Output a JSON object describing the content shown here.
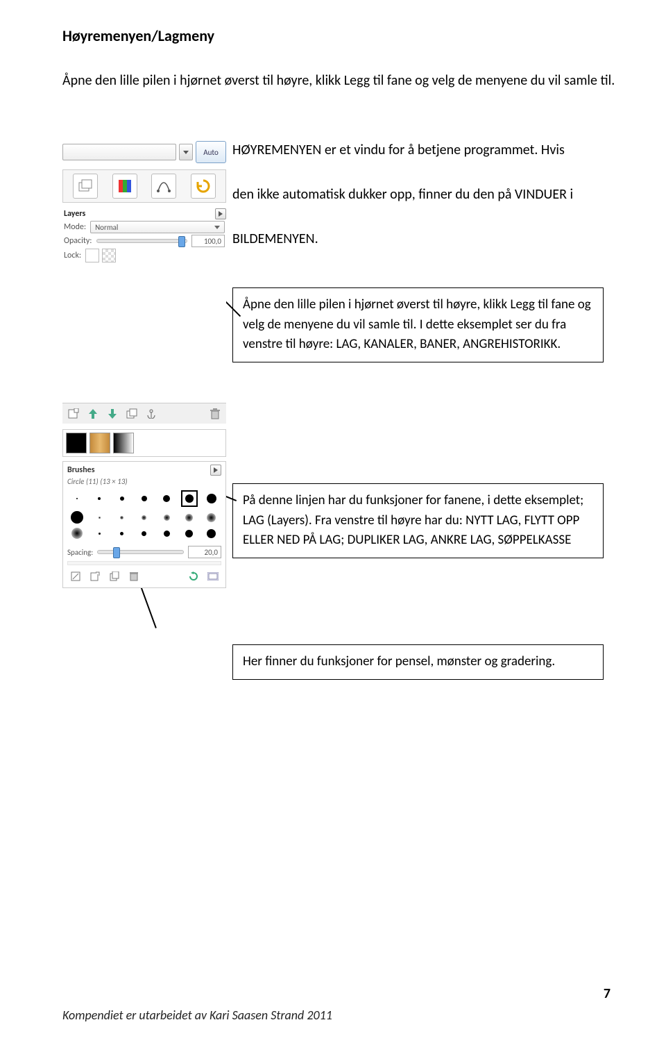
{
  "title": "Høyremenyen/Lagmeny",
  "intro_line1": "Åpne den lille pilen i hjørnet øverst til høyre, klikk Legg til fane og velg de menyene du vil samle til.",
  "intro2a": "HØYREMENYEN er et vindu for å betjene programmet. Hvis",
  "intro2b": "den ikke automatisk dukker opp, finner du den på VINDUER i",
  "intro2c": "BILDEMENYEN.",
  "callout1": "Åpne den lille pilen i hjørnet øverst til høyre, klikk Legg til fane og velg de menyene du vil samle til. I dette eksemplet ser du fra venstre til høyre: LAG, KANALER, BANER, ANGREHISTORIKK.",
  "callout2": "På denne linjen har du funksjoner for fanene, i dette eksemplet; LAG (Layers). Fra venstre til høyre har du: NYTT LAG, FLYTT OPP ELLER NED PÅ LAG; DUPLIKER LAG, ANKRE LAG, SØPPELKASSE",
  "callout3": "Her finner du funksjoner for pensel, mønster og gradering.",
  "panel": {
    "auto": "Auto",
    "layers_label": "Layers",
    "mode_label": "Mode:",
    "mode_value": "Normal",
    "opacity_label": "Opacity:",
    "opacity_value": "100,0",
    "lock_label": "Lock:",
    "brushes_label": "Brushes",
    "brush_name": "Circle (11) (13 × 13)",
    "spacing_label": "Spacing:",
    "spacing_value": "20,0"
  },
  "footer": "Kompendiet er utarbeidet av Kari Saasen Strand 2011",
  "page_number": "7"
}
